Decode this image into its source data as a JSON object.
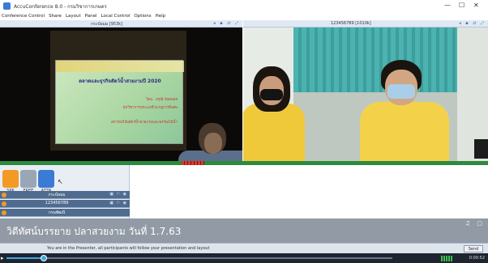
{
  "window": {
    "title": "AccuConference 8.0 - กรมวิชาการเกษตร",
    "controls": [
      "—",
      "☐",
      "✕"
    ]
  },
  "menu": [
    "Conference Control",
    "Share",
    "Layout",
    "Panel",
    "Local Control",
    "Options",
    "Help"
  ],
  "video": {
    "left_header": "กระป๋อมม [953k]",
    "right_header": "123456789 [1010k]",
    "header_icons": "◂ ▪ ⇄ ⤢",
    "slide": {
      "title": "ตลาดและธุรกิจสัตว์น้ำสวยงามปี 2020",
      "lines": [
        "โดย.. อรุณี รอดลอย",
        "นักวิชาการประมงชำนาญการพิเศษ",
        "สถาบันวิจัยสัตว์น้ำสวยงามและพรรณไม้น้ำ"
      ]
    }
  },
  "controls": {
    "buttons": [
      {
        "id": "spk",
        "label": "SPK",
        "color": "#f29a24"
      },
      {
        "id": "free",
        "label": "FREE",
        "color": "#9aa6b5"
      },
      {
        "id": "attn",
        "label": "ATTN",
        "color": "#3a7bd5"
      }
    ]
  },
  "participants": [
    {
      "name": "กระป๋อมม"
    },
    {
      "name": "123456789"
    },
    {
      "name": "กรมพัฒนี"
    }
  ],
  "caption": {
    "text": "วิดีทัศน์บรรยาย ปลาสวยงาม วันที่ 1.7.63",
    "icons": "♫ ▢"
  },
  "chat": {
    "status": "You are in the Presenter, all participants will follow your presentation and layout",
    "send_label": "Send"
  },
  "player": {
    "progress": 0.1,
    "time": "0:00:52"
  }
}
